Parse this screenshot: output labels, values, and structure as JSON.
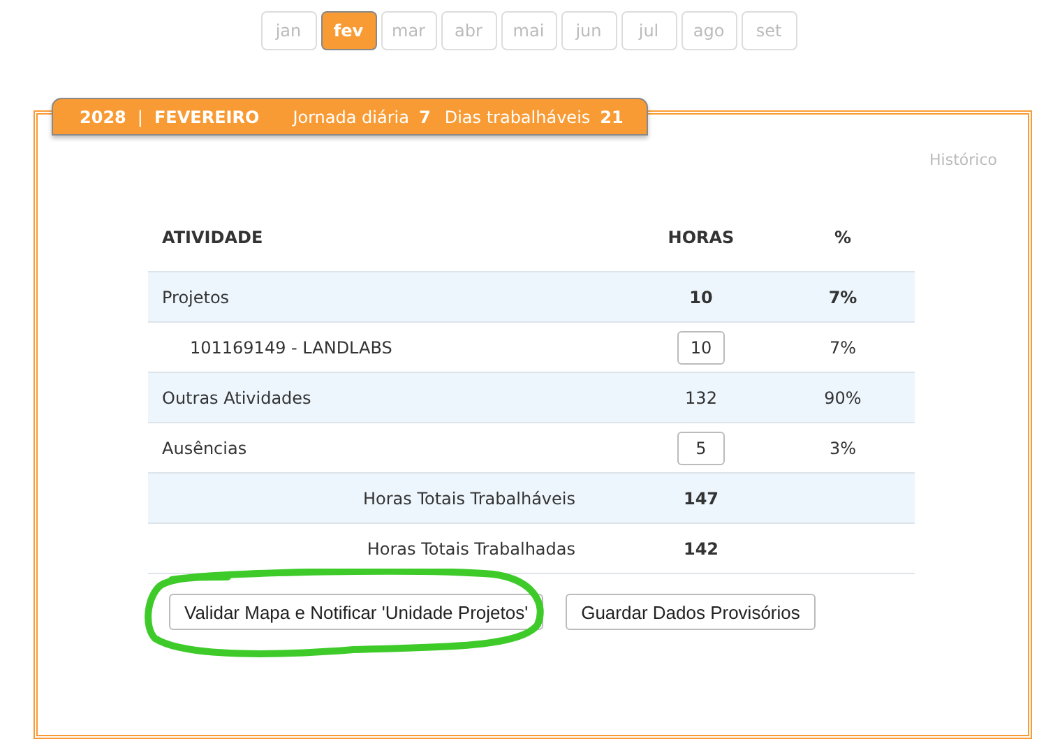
{
  "months": [
    {
      "label": "jan",
      "selected": false
    },
    {
      "label": "fev",
      "selected": true
    },
    {
      "label": "mar",
      "selected": false
    },
    {
      "label": "abr",
      "selected": false
    },
    {
      "label": "mai",
      "selected": false
    },
    {
      "label": "jun",
      "selected": false
    },
    {
      "label": "jul",
      "selected": false
    },
    {
      "label": "ago",
      "selected": false
    },
    {
      "label": "set",
      "selected": false
    }
  ],
  "header": {
    "year": "2028",
    "separator": "|",
    "month": "FEVEREIRO",
    "stats": [
      {
        "label": "Jornada diária",
        "value": "7"
      },
      {
        "label": "Dias trabalháveis",
        "value": "21"
      }
    ]
  },
  "history_link": "Histórico",
  "table": {
    "columns": [
      "ATIVIDADE",
      "HORAS",
      "%"
    ],
    "rows": [
      {
        "kind": "group",
        "label": "Projetos",
        "hours": "10",
        "percent": "7%",
        "editable": false
      },
      {
        "kind": "sub",
        "label": "101169149 - LANDLABS",
        "hours": "10",
        "percent": "7%",
        "editable": true
      },
      {
        "kind": "normal",
        "label": "Outras Atividades",
        "hours": "132",
        "percent": "90%",
        "editable": false
      },
      {
        "kind": "normal",
        "label": "Ausências",
        "hours": "5",
        "percent": "3%",
        "editable": true
      },
      {
        "kind": "total",
        "label": "Horas Totais Trabalháveis",
        "hours": "147"
      },
      {
        "kind": "total",
        "label": "Horas Totais Trabalhadas",
        "hours": "142"
      }
    ]
  },
  "buttons": [
    {
      "label": "Validar Mapa e Notificar 'Unidade Projetos'",
      "highlighted": true
    },
    {
      "label": "Guardar Dados Provisórios",
      "highlighted": false
    }
  ]
}
